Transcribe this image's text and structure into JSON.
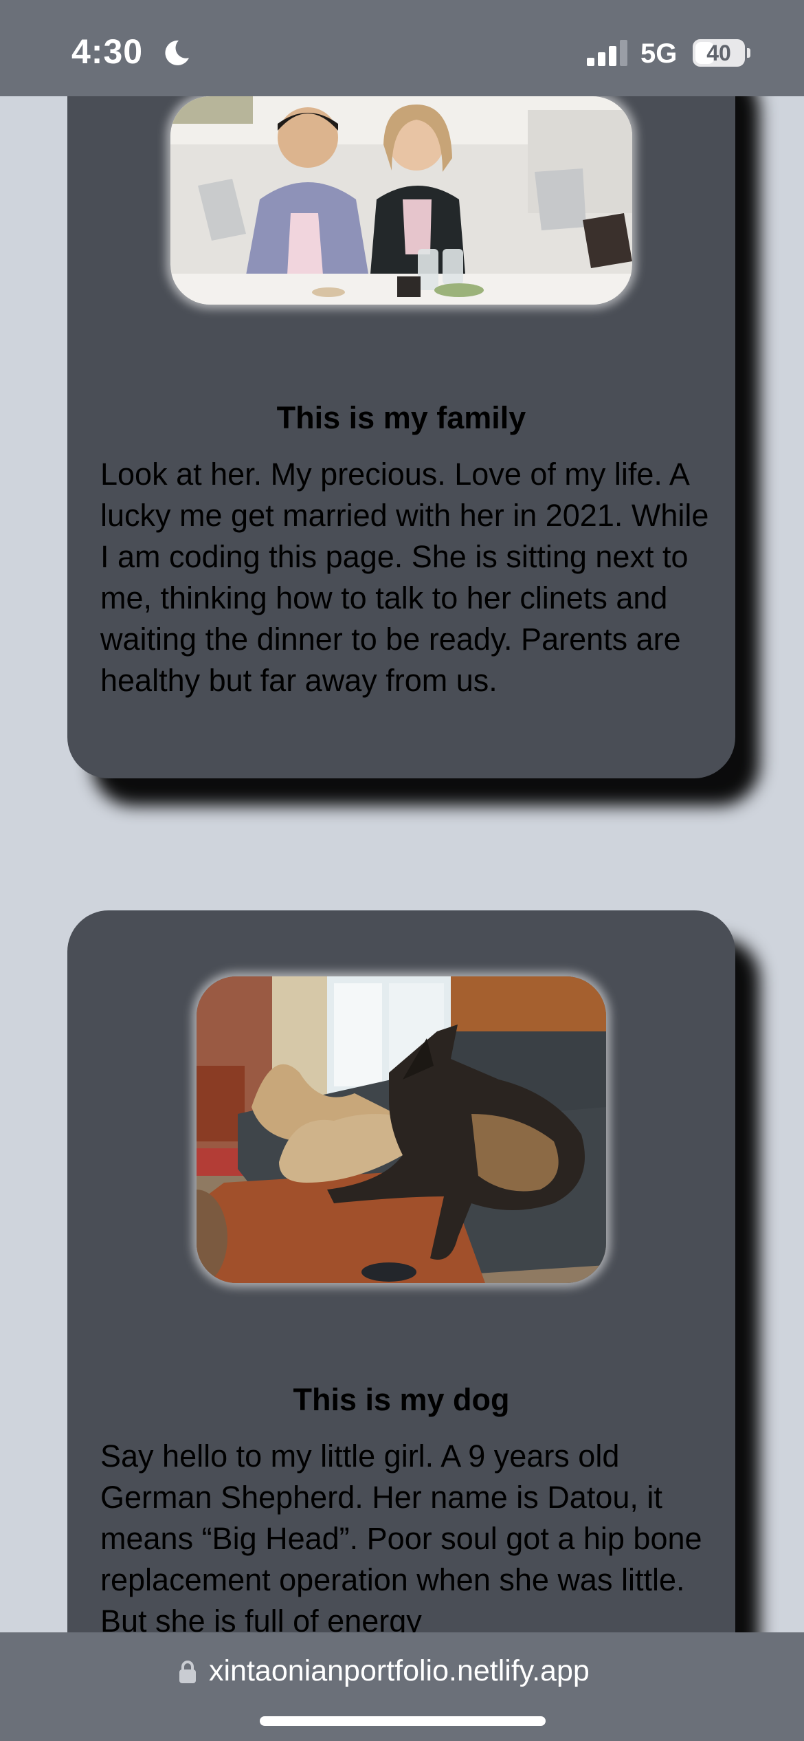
{
  "status_bar": {
    "time": "4:30",
    "network": "5G",
    "battery": "40",
    "battery_level": 0.4,
    "icons": [
      "moon-icon",
      "signal-icon",
      "battery-icon"
    ]
  },
  "cards": [
    {
      "title": "This is my family",
      "body": "Look at her. My precious. Love of my life. A lucky me get married with her in 2021. While I am coding this page. She is sitting next to me, thinking how to talk to her clinets and waiting the dinner to be ready. Parents are healthy but far away from us."
    },
    {
      "title": "This is my dog",
      "body": "Say hello to my little girl. A 9 years old German Shepherd. Her name is Datou, it means “Big Head”. Poor soul got a hip bone replacement operation when she was little. But she is full of energy"
    }
  ],
  "address_bar": {
    "url": "xintaonianportfolio.netlify.app",
    "icon": "lock-icon"
  },
  "colors": {
    "page_background": "#cfd4dc",
    "card_background": "#4a4e56",
    "bars": "#6b7079"
  }
}
